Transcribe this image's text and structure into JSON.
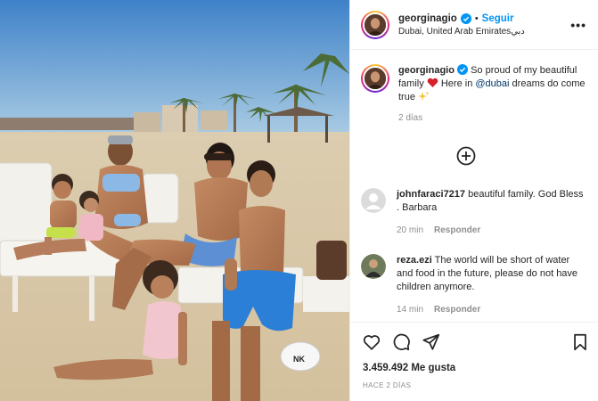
{
  "post": {
    "username": "georginagio",
    "follow_label": "Seguir",
    "separator": "•",
    "location": "Dubai, United Arab Emiratesدبي",
    "more_label": "•••"
  },
  "caption": {
    "username": "georginagio",
    "text_before_mention": "So proud of my beautiful family",
    "text_mid": "Here in",
    "mention": "@dubai",
    "text_after_mention": "dreams do come true",
    "time": "2 días"
  },
  "comments": [
    {
      "username": "johnfaraci7217",
      "text": "beautiful family. God Bless . Barbara",
      "time": "20 min",
      "reply_label": "Responder"
    },
    {
      "username": "reza.ezi",
      "text": "The world will be short of water and food in the future, please do not have children anymore.",
      "time": "14 min",
      "reply_label": "Responder"
    }
  ],
  "likes": "3.459.492 Me gusta",
  "post_date": "HACE 2 DÍAS",
  "icons": {
    "verified": "verified-badge-icon",
    "like": "heart-icon",
    "comment": "comment-bubble-icon",
    "share": "paper-plane-icon",
    "save": "bookmark-icon",
    "load_more": "plus-circle-icon"
  },
  "colors": {
    "accent": "#0095f6",
    "text": "#262626",
    "muted": "#8e8e8e",
    "mention": "#00376b"
  }
}
